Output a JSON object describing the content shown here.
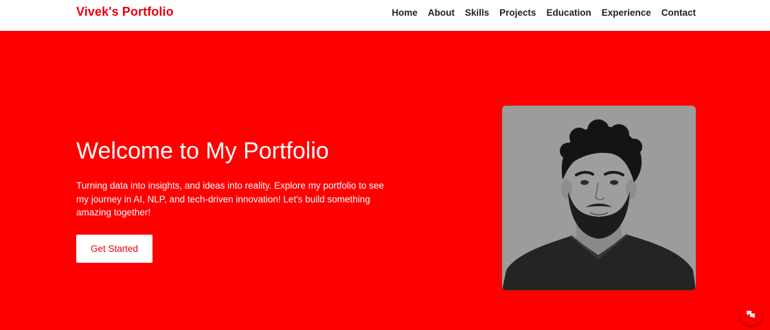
{
  "brand": {
    "name": "Vivek's Portfolio"
  },
  "nav": {
    "links": [
      "Home",
      "About",
      "Skills",
      "Projects",
      "Education",
      "Experience",
      "Contact"
    ]
  },
  "hero": {
    "title": "Welcome to My Portfolio",
    "description": "Turning data into insights, and ideas into reality. Explore my portfolio to see my journey in AI, NLP, and tech-driven innovation! Let's build something amazing together!",
    "cta_label": "Get Started"
  },
  "chat_widget": {
    "icon": "chat-icon"
  },
  "colors": {
    "accent": "#ff0000",
    "brand_text": "#e8000b",
    "nav_text": "#222222"
  }
}
